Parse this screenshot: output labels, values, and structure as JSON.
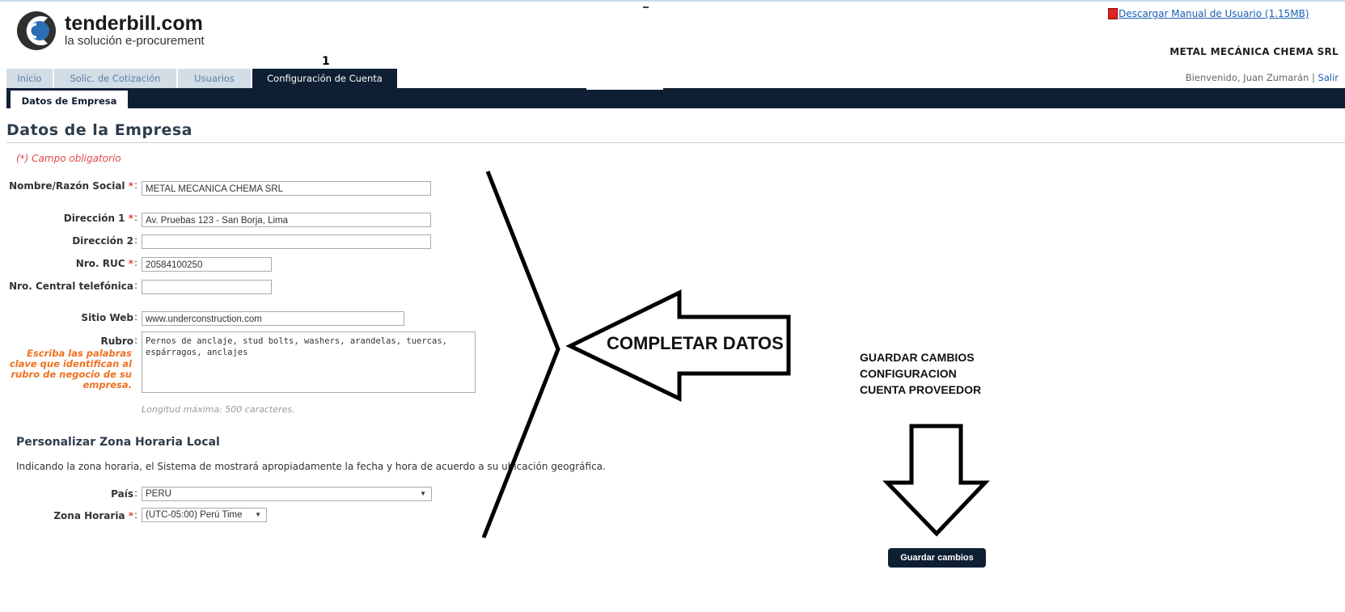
{
  "header": {
    "brand_name": "tenderbill.com",
    "brand_tagline": "la solución e-procurement",
    "manual_link": "Descargar Manual de Usuario (1.15MB)",
    "company_name": "METAL MECÁNICA CHEMA SRL",
    "welcome_text": "Bienvenido, Juan Zumarán",
    "separator": "|",
    "logout_label": "Salir",
    "step_number": "1"
  },
  "tabs": [
    {
      "label": "Inicio"
    },
    {
      "label": "Solic. de Cotización"
    },
    {
      "label": "Usuarios"
    },
    {
      "label": "Configuración de Cuenta",
      "active": true
    }
  ],
  "subtab": {
    "label": "Datos de Empresa"
  },
  "page": {
    "title": "Datos de la Empresa",
    "required_note": "(*) Campo obligatorio"
  },
  "form": {
    "nombre": {
      "label": "Nombre/Razón Social",
      "value": "METAL MECANICA CHEMA SRL"
    },
    "direccion1": {
      "label": "Dirección 1",
      "value": "Av. Pruebas 123 - San Borja, Lima"
    },
    "direccion2": {
      "label": "Dirección 2",
      "value": ""
    },
    "ruc": {
      "label": "Nro. RUC",
      "value": "20584100250"
    },
    "central": {
      "label": "Nro. Central telefónica",
      "value": ""
    },
    "web": {
      "label": "Sitio Web",
      "value": "www.underconstruction.com"
    },
    "rubro": {
      "label": "Rubro",
      "hint": "Escriba las palabras clave que identifican al rubro de negocio de su empresa.",
      "value": "Pernos de anclaje, stud bolts, washers, arandelas, tuercas, espárragos, anclajes",
      "max_length_note": "Longitud máxima: 500 caracteres."
    },
    "required_mark": "*",
    "colon": ":"
  },
  "timezone": {
    "heading": "Personalizar Zona Horaria Local",
    "description": "Indicando la zona horaria, el Sistema de mostrará apropiadamente la fecha y hora de acuerdo a su ubicación geográfica.",
    "pais": {
      "label": "País",
      "value": "PERU"
    },
    "zona": {
      "label": "Zona Horaria",
      "value": "(UTC-05:00) Perú Time"
    }
  },
  "save_button": "Guardar cambios",
  "annotations": {
    "completar": "COMPLETAR DATOS",
    "guardar_lines": [
      "GUARDAR CAMBIOS",
      "CONFIGURACION",
      "CUENTA PROVEEDOR"
    ]
  },
  "colors": {
    "nav_dark": "#0f1f33",
    "tab_inactive": "#d3dde6",
    "required_red": "#e04848",
    "hint_orange": "#f07020",
    "link_blue": "#1a5fb4"
  }
}
